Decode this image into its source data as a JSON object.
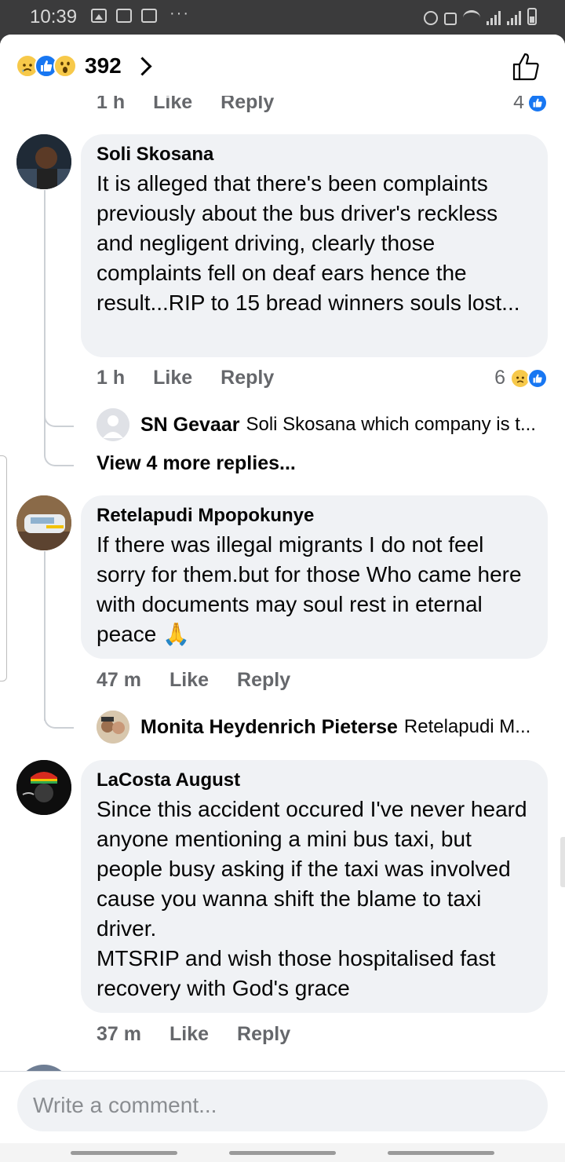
{
  "status_bar": {
    "time": "10:39"
  },
  "header": {
    "reaction_count": "392",
    "reactions": [
      "sad",
      "like",
      "wow"
    ]
  },
  "prev_comment_meta": {
    "time": "1 h",
    "like": "Like",
    "reply": "Reply",
    "reaction_count": "4"
  },
  "comments": [
    {
      "author": "Soli Skosana",
      "text": "It is alleged that there's been complaints previously about the bus driver's reckless and negligent driving, clearly those complaints fell on deaf ears hence the result...RIP to 15 bread winners souls lost...",
      "time": "1 h",
      "like": "Like",
      "reply": "Reply",
      "reaction_count": "6",
      "replies_preview": {
        "author": "SN Gevaar",
        "text": "Soli Skosana which company is t..."
      },
      "view_more": "View 4 more replies..."
    },
    {
      "author": "Retelapudi Mpopokunye",
      "text": "If there was illegal migrants I do not feel sorry for them.but for those Who came here with documents may soul rest in eternal peace 🙏",
      "time": "47 m",
      "like": "Like",
      "reply": "Reply",
      "replies_preview": {
        "author": "Monita Heydenrich Pieterse",
        "text": "Retelapudi M..."
      }
    },
    {
      "author": "LaCosta August",
      "text": "Since this accident occured I've never heard anyone mentioning a mini bus taxi, but people busy asking if the taxi was involved cause you wanna shift the blame to taxi driver.\nMTSRIP and wish those hospitalised fast recovery with God's grace",
      "time": "37 m",
      "like": "Like",
      "reply": "Reply"
    }
  ],
  "composer": {
    "placeholder": "Write a comment..."
  },
  "colors": {
    "like_blue": "#1877f2",
    "bubble_bg": "#f0f2f5",
    "meta_gray": "#65676b",
    "status_bar_bg": "#3b3b3c"
  }
}
